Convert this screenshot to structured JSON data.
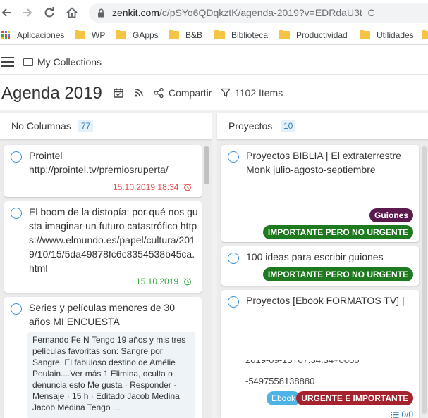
{
  "browser": {
    "url_host": "zenkit.com",
    "url_path": "/c/pSYo6QDqkztK/agenda-2019?v=EDRdaU3t_C",
    "bookmarks": [
      {
        "label": "Aplicaciones",
        "icon": "apps-icon"
      },
      {
        "label": "WP",
        "icon": "folder-icon"
      },
      {
        "label": "GApps",
        "icon": "folder-icon"
      },
      {
        "label": "B&B",
        "icon": "folder-icon"
      },
      {
        "label": "Biblioteca",
        "icon": "folder-icon"
      },
      {
        "label": "Productividad",
        "icon": "folder-icon"
      },
      {
        "label": "Utilidades",
        "icon": "folder-icon"
      }
    ]
  },
  "app": {
    "breadcrumb": "My Collections",
    "title": "Agenda 2019",
    "share_label": "Compartir",
    "filter_label": "1102 Items"
  },
  "columns": [
    {
      "title": "No Columnas",
      "count": "77",
      "cards": [
        {
          "title": "Prointel\nhttp://prointel.tv/premiosruperta/",
          "date": "15.10.2019 18:34",
          "date_status": "overdue"
        },
        {
          "title": "El boom de la distopía: por qué nos gusta imaginar un futuro catastrófico https://www.elmundo.es/papel/cultura/2019/10/15/5da49878fc6c8354538b45ca.html",
          "date": "15.10.2019",
          "date_status": "ok"
        },
        {
          "title": "Series y películas menores de 30 años MI ENCUESTA",
          "comment": "Fernando Fe N Tengo 19 años y mis tres películas favoritas son: Sangre por Sangre. El fabuloso destino de Amélie Poulain....Ver más 1 Elimina, oculta o denuncia esto Me gusta · Responder · Mensaje · 15 h · Editado Jacob Medina Jacob Medina Tengo ..."
        }
      ]
    },
    {
      "title": "Proyectos",
      "count": "10",
      "cards": [
        {
          "title": "Proyectos BIBLIA | El extraterrestre Monk julio-agosto-septiembre",
          "tags": [
            "Guiones",
            "IMPORTANTE PERO NO URGENTE"
          ]
        },
        {
          "title": "100 ideas para escribir guiones",
          "tags": [
            "IMPORTANTE PERO NO URGENTE"
          ]
        },
        {
          "title": "Proyectos [Ebook FORMATOS TV] |",
          "clipped_line1": "2019-09-13T07:34:34+0000",
          "clipped_line2": "-5497558138880",
          "tags": [
            "Ebook",
            "URGENTE E IMPORTANTE"
          ],
          "subtasks": "0/0"
        }
      ]
    }
  ],
  "colors": {
    "accent": "#3b8fd8",
    "tag_guiones": "#5b1a4e",
    "tag_important": "#1e7a1e",
    "tag_urgent": "#a4232f",
    "tag_ebook": "#4db3e6",
    "date_overdue": "#e04f4f",
    "date_ok": "#3aa845"
  }
}
